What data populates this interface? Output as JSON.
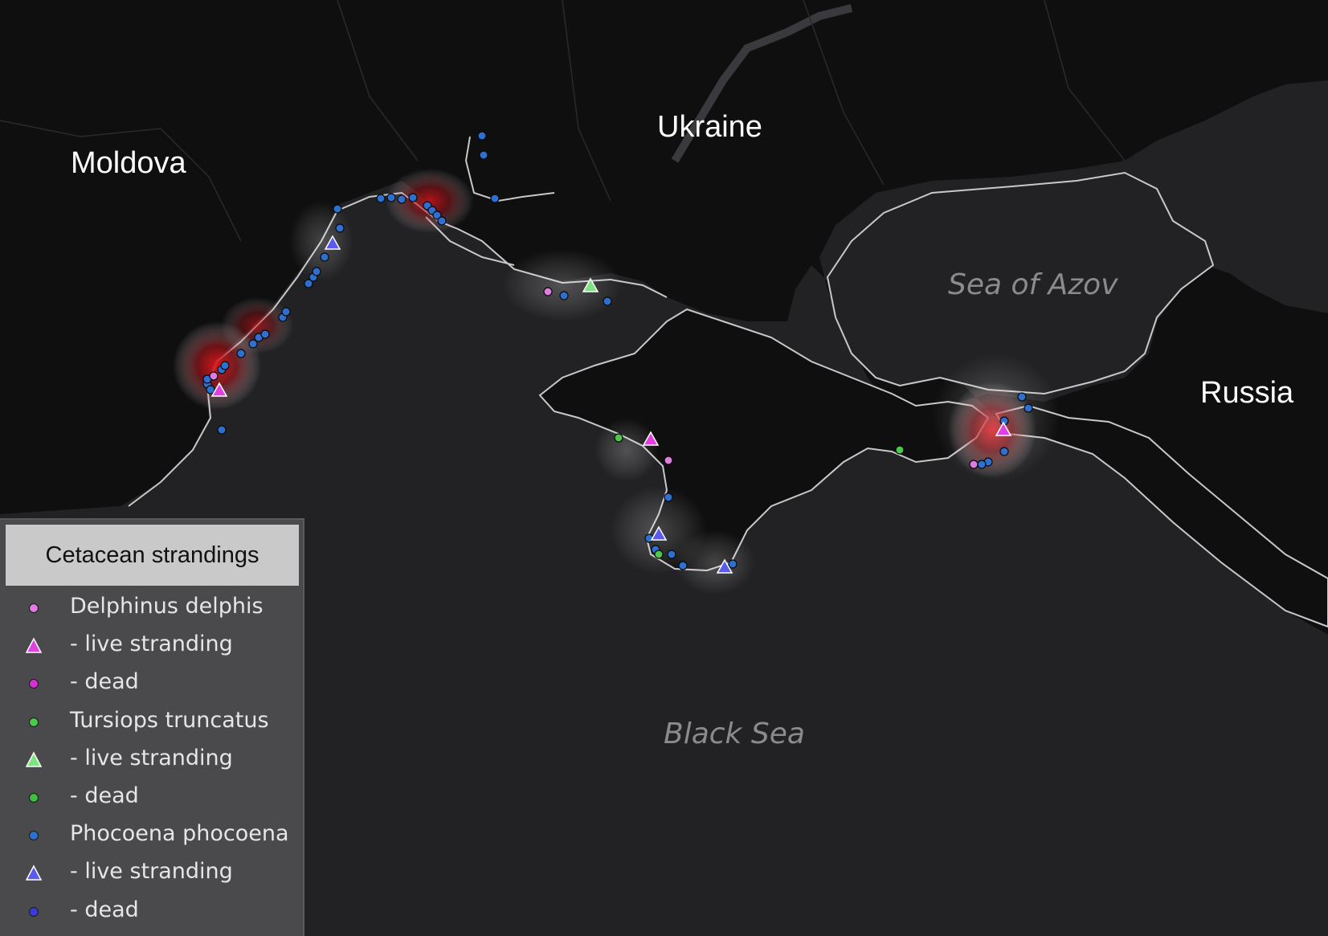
{
  "map": {
    "country_labels": [
      {
        "id": "moldova",
        "text": "Moldova"
      },
      {
        "id": "ukraine",
        "text": "Ukraine"
      },
      {
        "id": "russia",
        "text": "Russia"
      }
    ],
    "sea_labels": [
      {
        "id": "sea-of-azov",
        "text": "Sea of Azov"
      },
      {
        "id": "black-sea",
        "text": "Black Sea"
      }
    ],
    "colors": {
      "land": "#0f0f10",
      "sea": "#222224",
      "coastline": "#c8c8cc",
      "heat": "#e3151b",
      "delphinus_dead": "#e07be0",
      "delphinus_live": "#e040e0",
      "tursiops_dead": "#4cc84c",
      "tursiops_live": "#7ee27e",
      "phocoena_dead": "#2f6fd0",
      "phocoena_live": "#5a5aee"
    }
  },
  "legend": {
    "title": "Cetacean strandings",
    "items": [
      {
        "id": "delphinus",
        "label": "Delphinus delphis",
        "symbol": "circle",
        "color": "#e07be0"
      },
      {
        "id": "delphinus-live",
        "label": "- live stranding",
        "symbol": "triangle",
        "color": "#e040e0"
      },
      {
        "id": "delphinus-dead",
        "label": "- dead",
        "symbol": "circle",
        "color": "#d62fd6"
      },
      {
        "id": "tursiops",
        "label": "Tursiops truncatus",
        "symbol": "circle",
        "color": "#4cc84c"
      },
      {
        "id": "tursiops-live",
        "label": "- live stranding",
        "symbol": "triangle",
        "color": "#7ee27e"
      },
      {
        "id": "tursiops-dead",
        "label": "- dead",
        "symbol": "circle",
        "color": "#3fbf3f"
      },
      {
        "id": "phocoena",
        "label": "Phocoena phocoena",
        "symbol": "circle",
        "color": "#2f6fd0"
      },
      {
        "id": "phocoena-live",
        "label": "- live stranding",
        "symbol": "triangle",
        "color": "#5a5aee"
      },
      {
        "id": "phocoena-dead",
        "label": "- dead",
        "symbol": "circle",
        "color": "#3a3ad8"
      }
    ]
  }
}
